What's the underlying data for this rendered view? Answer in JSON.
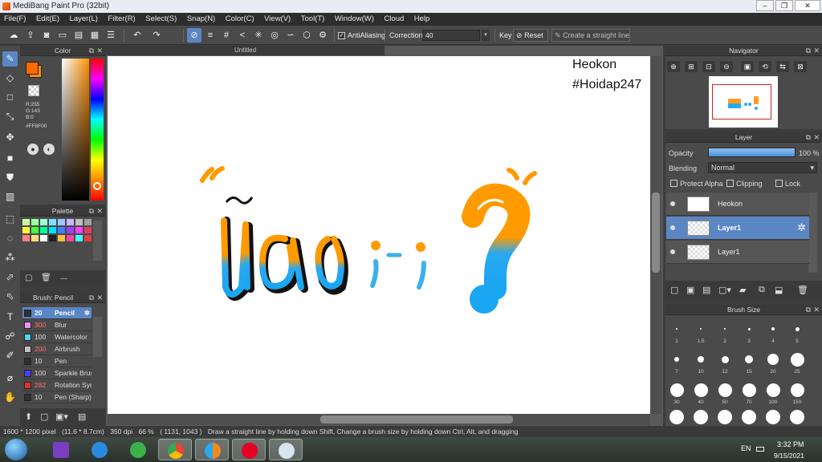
{
  "app": {
    "title": "MediBang Paint Pro (32bit)"
  },
  "menu": [
    "File(F)",
    "Edit(E)",
    "Layer(L)",
    "Filter(R)",
    "Select(S)",
    "Snap(N)",
    "Color(C)",
    "View(V)",
    "Tool(T)",
    "Window(W)",
    "Cloud",
    "Help"
  ],
  "toolbar": {
    "antialiasing_label": "AntiAliasing",
    "correction_label": "Correction",
    "correction_value": "40",
    "key_label": "Key",
    "reset_label": "Reset",
    "straight_line_label": "Create a straight line"
  },
  "color_panel": {
    "title": "Color",
    "r": "R:255",
    "g": "G:143",
    "b": "B:0",
    "hex": "#FF8F00",
    "main_color": "#FF8F00"
  },
  "palette_panel": {
    "title": "Palette",
    "footer": "---",
    "colors": [
      "#c8ff9e",
      "#9eff9e",
      "#9effd0",
      "#7fe0ff",
      "#9ec8ff",
      "#c8b8ff",
      "#c0c0c0",
      "#a0a0a0",
      "#ffff40",
      "#40ff40",
      "#00ffa0",
      "#00e0ff",
      "#4080ff",
      "#a040ff",
      "#ff40ff",
      "#e04060",
      "#ff8080",
      "#ffe080",
      "#ffffff",
      "#202020",
      "#ffc040",
      "#ff40a0",
      "#40ffff",
      "#e04040"
    ]
  },
  "brush_panel": {
    "title": "Brush: Pencil",
    "items": [
      {
        "size": "20",
        "name": "Pencil",
        "color": "#303030",
        "selected": true
      },
      {
        "size": "300",
        "name": "Blur",
        "color": "#f090f0"
      },
      {
        "size": "100",
        "name": "Watercolor",
        "color": "#50d0f0"
      },
      {
        "size": "200",
        "name": "Airbrush",
        "color": "#c0c0c0"
      },
      {
        "size": "10",
        "name": "Pen",
        "color": "#303030"
      },
      {
        "size": "100",
        "name": "Sparkle Brush",
        "color": "#4040ff"
      },
      {
        "size": "282",
        "name": "Rotation Sym",
        "color": "#e03030"
      },
      {
        "size": "10",
        "name": "Pen (Sharp)",
        "color": "#303030"
      }
    ]
  },
  "document": {
    "tab_title": "Untitled",
    "text_line1": "Heokon",
    "text_line2": "#Hoidap247",
    "drawing": {
      "word1": "ừa",
      "word2": ";-;",
      "word3": "?"
    }
  },
  "navigator": {
    "title": "Navigator"
  },
  "layer_panel": {
    "title": "Layer",
    "opacity_label": "Opacity",
    "opacity_value": "100 %",
    "opacity": 1.0,
    "blending_label": "Blending",
    "blending_value": "Normal",
    "protect_alpha_label": "Protect Alpha",
    "clipping_label": "Clipping",
    "lock_label": "Lock",
    "layers": [
      {
        "name": "Heokon",
        "selected": false
      },
      {
        "name": "Layer1",
        "selected": true
      },
      {
        "name": "Layer1",
        "selected": false
      }
    ]
  },
  "brushsize_panel": {
    "title": "Brush Size",
    "sizes": [
      "1",
      "1.5",
      "2",
      "3",
      "4",
      "5",
      "7",
      "10",
      "12",
      "15",
      "20",
      "25",
      "30",
      "40",
      "50",
      "70",
      "100",
      "150"
    ]
  },
  "status": {
    "size": "1600 * 1200 pixel",
    "cm": "(11.6 * 8.7cm)",
    "dpi": "350 dpi",
    "zoom": "66 %",
    "coords": "( 1131, 1043 )",
    "hint": "Draw a straight line by holding down Shift, Change a brush size by holding down Ctrl, Alt, and dragging"
  },
  "taskbar": {
    "lang": "EN",
    "time": "3:32 PM",
    "date": "9/15/2021"
  }
}
